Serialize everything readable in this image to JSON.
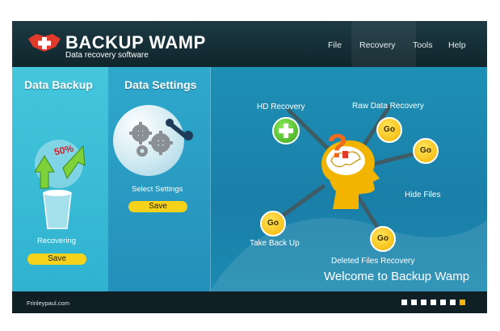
{
  "header": {
    "brand": "BACKUP WAMP",
    "tagline": "Data recovery software",
    "logo_icon": "plus-badge-icon",
    "menu": [
      "File",
      "Recovery",
      "Tools",
      "Help"
    ]
  },
  "backup_panel": {
    "title": "Data Backup",
    "progress_label": "50%",
    "progress_percent": 50,
    "status": "Recovering",
    "button": "Save"
  },
  "settings_panel": {
    "title": "Data Settings",
    "caption": "Select Settings",
    "button": "Save"
  },
  "features": {
    "hd_recovery": "HD Recovery",
    "raw_data_recovery": "Raw Data Recovery",
    "hide_files": "Hide Files",
    "take_back_up": "Take Back Up",
    "deleted_files_recovery": "Deleted Files Recovery",
    "go_label": "Go",
    "question_mark": "?"
  },
  "welcome": "Welcome to Backup Wamp",
  "footer": {
    "site": "Frinleypaul.com",
    "pagination": {
      "count": 7,
      "active_index": 6
    }
  },
  "colors": {
    "accent_yellow": "#f7d21a",
    "go_orange": "#f2b400",
    "plus_green": "#4cc22e",
    "header_dark": "#142b33",
    "panel_blue": "#1e8fb5"
  }
}
